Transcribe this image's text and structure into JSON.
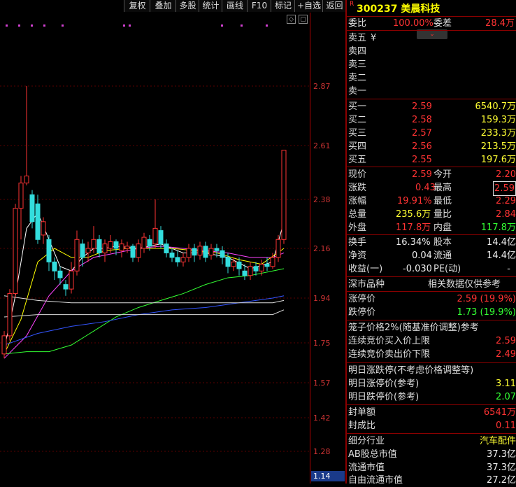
{
  "toolbar": {
    "buttons": [
      "复权",
      "叠加",
      "多股",
      "统计",
      "画线",
      "F10",
      "标记",
      "+自选",
      "返回"
    ]
  },
  "price_axis": {
    "ticks": [
      "2.87",
      "2.61",
      "2.38",
      "2.16",
      "1.94",
      "1.75",
      "1.57",
      "1.42",
      "1.28"
    ],
    "cursor_value": "1.14"
  },
  "small_buttons": [
    "◇",
    "▢"
  ],
  "stock": {
    "r_mark": "R",
    "code_name": "300237 美晨科技"
  },
  "ratio": {
    "wb_label": "委比",
    "wb_value": "100.00%",
    "wc_label": "委差",
    "wc_value": "28.4万",
    "tag": "⌄"
  },
  "asks": [
    {
      "label": "卖五",
      "extra": "¥"
    },
    {
      "label": "卖四",
      "extra": ""
    },
    {
      "label": "卖三",
      "extra": ""
    },
    {
      "label": "卖二",
      "extra": ""
    },
    {
      "label": "卖一",
      "extra": ""
    }
  ],
  "bids": [
    {
      "label": "买一",
      "price": "2.59",
      "vol": "6540.7万"
    },
    {
      "label": "买二",
      "price": "2.58",
      "vol": "159.3万"
    },
    {
      "label": "买三",
      "price": "2.57",
      "vol": "233.3万"
    },
    {
      "label": "买四",
      "price": "2.56",
      "vol": "213.5万"
    },
    {
      "label": "买五",
      "price": "2.55",
      "vol": "197.6万"
    }
  ],
  "quote": [
    {
      "l1": "现价",
      "v1": "2.59",
      "l2": "今开",
      "v2": "2.20"
    },
    {
      "l1": "涨跌",
      "v1": "0.43",
      "l2": "最高",
      "v2": "2.59"
    },
    {
      "l1": "涨幅",
      "v1": "19.91%",
      "l2": "最低",
      "v2": "2.29"
    },
    {
      "l1": "总量",
      "v1": "235.6万",
      "l2": "量比",
      "v2": "2.84"
    },
    {
      "l1": "外盘",
      "v1": "117.8万",
      "l2": "内盘",
      "v2": "117.8万"
    }
  ],
  "stats": [
    {
      "l1": "换手",
      "v1": "16.34%",
      "l2": "股本",
      "v2": "14.4亿"
    },
    {
      "l1": "净资",
      "v1": "0.04",
      "l2": "流通",
      "v2": "14.4亿"
    },
    {
      "l1": "收益(一)",
      "v1": "-0.030",
      "l2": "PE(动)",
      "v2": "-"
    }
  ],
  "section": {
    "left": "深市品种",
    "right": "相关数据仅供参考"
  },
  "limits": [
    {
      "label": "涨停价",
      "value": "2.59 (19.9%)"
    },
    {
      "label": "跌停价",
      "value": "1.73 (19.9%)"
    }
  ],
  "cage": {
    "title": "笼子价格2%(随基准价调整)参考",
    "rows": [
      {
        "label": "连续竞价买入价上限",
        "value": "2.59"
      },
      {
        "label": "连续竞价卖出价下限",
        "value": "2.49"
      }
    ]
  },
  "tomorrow": {
    "title": "明日涨跌停(不考虑价格调整等)",
    "rows": [
      {
        "label": "明日涨停价(参考)",
        "value": "3.11"
      },
      {
        "label": "明日跌停价(参考)",
        "value": "2.07"
      }
    ]
  },
  "seal": [
    {
      "label": "封单额",
      "value": "6541万"
    },
    {
      "label": "封成比",
      "value": "0.11"
    }
  ],
  "industry": {
    "label": "细分行业",
    "value": "汽车配件"
  },
  "caps": [
    {
      "label": "AB股总市值",
      "value": "37.3亿"
    },
    {
      "label": "流通市值",
      "value": "37.3亿"
    },
    {
      "label": "自由流通市值",
      "value": "27.2亿"
    }
  ],
  "colors": {
    "up": "#ff3333",
    "down": "#33dddd",
    "ma5": "#ffffff",
    "ma10": "#ffff00",
    "ma20": "#ff44ff",
    "ma30": "#33ff33",
    "ma60": "#3355ff",
    "ma120": "#dddddd"
  },
  "chart_data": {
    "type": "candlestick",
    "candles": [
      [
        1.7,
        1.78,
        1.68,
        1.8
      ],
      [
        1.78,
        1.96,
        1.76,
        1.98
      ],
      [
        1.96,
        2.34,
        1.94,
        2.36
      ],
      [
        2.34,
        2.45,
        2.2,
        2.48
      ],
      [
        2.45,
        2.48,
        2.44,
        2.87
      ],
      [
        2.4,
        2.28,
        2.25,
        2.42
      ],
      [
        2.36,
        2.2,
        2.18,
        2.4
      ],
      [
        2.22,
        2.28,
        2.18,
        2.3
      ],
      [
        2.2,
        2.1,
        2.06,
        2.22
      ],
      [
        2.1,
        2.06,
        2.02,
        2.12
      ],
      [
        2.06,
        2.03,
        2.0,
        2.08
      ],
      [
        2.0,
        1.98,
        1.95,
        2.02
      ],
      [
        1.98,
        2.06,
        1.96,
        2.1
      ],
      [
        2.06,
        2.2,
        2.04,
        2.24
      ],
      [
        2.18,
        2.12,
        2.08,
        2.2
      ],
      [
        2.14,
        2.16,
        2.1,
        2.19
      ],
      [
        2.16,
        2.2,
        2.14,
        2.26
      ],
      [
        2.2,
        2.14,
        2.12,
        2.22
      ],
      [
        2.14,
        2.18,
        2.1,
        2.2
      ],
      [
        2.16,
        2.19,
        2.14,
        2.22
      ],
      [
        2.19,
        2.16,
        2.13,
        2.2
      ],
      [
        2.15,
        2.18,
        2.12,
        2.2
      ],
      [
        2.16,
        2.17,
        2.14,
        2.19
      ],
      [
        2.17,
        2.12,
        2.1,
        2.18
      ],
      [
        2.12,
        2.18,
        2.1,
        2.2
      ],
      [
        2.16,
        2.21,
        2.14,
        2.23
      ],
      [
        2.2,
        2.17,
        2.15,
        2.22
      ],
      [
        2.18,
        2.25,
        2.16,
        2.38
      ],
      [
        2.24,
        2.18,
        2.16,
        2.26
      ],
      [
        2.18,
        2.14,
        2.12,
        2.2
      ],
      [
        2.14,
        2.12,
        2.1,
        2.16
      ],
      [
        2.12,
        2.1,
        2.08,
        2.15
      ],
      [
        2.1,
        2.12,
        2.08,
        2.14
      ],
      [
        2.12,
        2.16,
        2.1,
        2.18
      ],
      [
        2.16,
        2.13,
        2.1,
        2.18
      ],
      [
        2.13,
        2.17,
        2.11,
        2.19
      ],
      [
        2.17,
        2.12,
        2.1,
        2.19
      ],
      [
        2.13,
        2.16,
        2.11,
        2.18
      ],
      [
        2.16,
        2.15,
        2.12,
        2.18
      ],
      [
        2.15,
        2.12,
        2.09,
        2.17
      ],
      [
        2.12,
        2.08,
        2.05,
        2.14
      ],
      [
        2.08,
        2.1,
        2.06,
        2.12
      ],
      [
        2.1,
        2.07,
        2.04,
        2.12
      ],
      [
        2.06,
        2.04,
        2.02,
        2.09
      ],
      [
        2.04,
        2.08,
        2.02,
        2.1
      ],
      [
        2.08,
        2.06,
        2.04,
        2.1
      ],
      [
        2.06,
        2.09,
        2.04,
        2.11
      ],
      [
        2.09,
        2.08,
        2.06,
        2.12
      ],
      [
        2.08,
        2.12,
        2.07,
        2.14
      ],
      [
        2.12,
        2.2,
        2.1,
        2.22
      ],
      [
        2.2,
        2.59,
        2.18,
        2.59
      ]
    ],
    "ma": {
      "ma5": [
        [
          0,
          1.72
        ],
        [
          2,
          1.95
        ],
        [
          4,
          2.25
        ],
        [
          6,
          2.32
        ],
        [
          8,
          2.2
        ],
        [
          10,
          2.08
        ],
        [
          12,
          2.06
        ],
        [
          14,
          2.12
        ],
        [
          16,
          2.16
        ],
        [
          18,
          2.16
        ],
        [
          20,
          2.17
        ],
        [
          24,
          2.16
        ],
        [
          28,
          2.18
        ],
        [
          32,
          2.14
        ],
        [
          36,
          2.14
        ],
        [
          40,
          2.12
        ],
        [
          44,
          2.07
        ],
        [
          48,
          2.1
        ],
        [
          50,
          2.28
        ]
      ],
      "ma10": [
        [
          0,
          1.7
        ],
        [
          3,
          1.85
        ],
        [
          6,
          2.1
        ],
        [
          9,
          2.16
        ],
        [
          12,
          2.12
        ],
        [
          15,
          2.12
        ],
        [
          18,
          2.15
        ],
        [
          22,
          2.16
        ],
        [
          26,
          2.16
        ],
        [
          30,
          2.16
        ],
        [
          34,
          2.15
        ],
        [
          38,
          2.14
        ],
        [
          42,
          2.11
        ],
        [
          46,
          2.09
        ],
        [
          50,
          2.16
        ]
      ],
      "ma20": [
        [
          0,
          1.68
        ],
        [
          4,
          1.78
        ],
        [
          8,
          1.95
        ],
        [
          12,
          2.06
        ],
        [
          16,
          2.12
        ],
        [
          20,
          2.14
        ],
        [
          24,
          2.16
        ],
        [
          28,
          2.17
        ],
        [
          32,
          2.16
        ],
        [
          36,
          2.15
        ],
        [
          40,
          2.14
        ],
        [
          44,
          2.12
        ],
        [
          48,
          2.12
        ],
        [
          50,
          2.14
        ]
      ],
      "ma30": [
        [
          0,
          1.7
        ],
        [
          4,
          1.71
        ],
        [
          8,
          1.71
        ],
        [
          12,
          1.74
        ],
        [
          16,
          1.8
        ],
        [
          20,
          1.86
        ],
        [
          24,
          1.9
        ],
        [
          28,
          1.93
        ],
        [
          32,
          1.96
        ],
        [
          36,
          2.0
        ],
        [
          40,
          2.03
        ],
        [
          44,
          2.04
        ],
        [
          48,
          2.06
        ],
        [
          50,
          2.07
        ]
      ],
      "ma60": [
        [
          0,
          1.74
        ],
        [
          6,
          1.79
        ],
        [
          12,
          1.82
        ],
        [
          18,
          1.84
        ],
        [
          24,
          1.87
        ],
        [
          30,
          1.89
        ],
        [
          36,
          1.9
        ],
        [
          42,
          1.92
        ],
        [
          48,
          1.94
        ],
        [
          50,
          1.95
        ]
      ],
      "ma120": [
        [
          0,
          1.95
        ],
        [
          6,
          1.93
        ],
        [
          12,
          1.92
        ],
        [
          18,
          1.92
        ],
        [
          24,
          1.92
        ],
        [
          30,
          1.92
        ],
        [
          36,
          1.92
        ],
        [
          42,
          1.92
        ],
        [
          48,
          1.92
        ],
        [
          50,
          1.93
        ]
      ],
      "ma250": [
        [
          0,
          1.86
        ],
        [
          6,
          1.87
        ],
        [
          12,
          1.87
        ],
        [
          18,
          1.87
        ],
        [
          24,
          1.87
        ],
        [
          30,
          1.87
        ],
        [
          36,
          1.87
        ],
        [
          42,
          1.87
        ],
        [
          48,
          1.87
        ],
        [
          50,
          1.89
        ]
      ]
    }
  }
}
